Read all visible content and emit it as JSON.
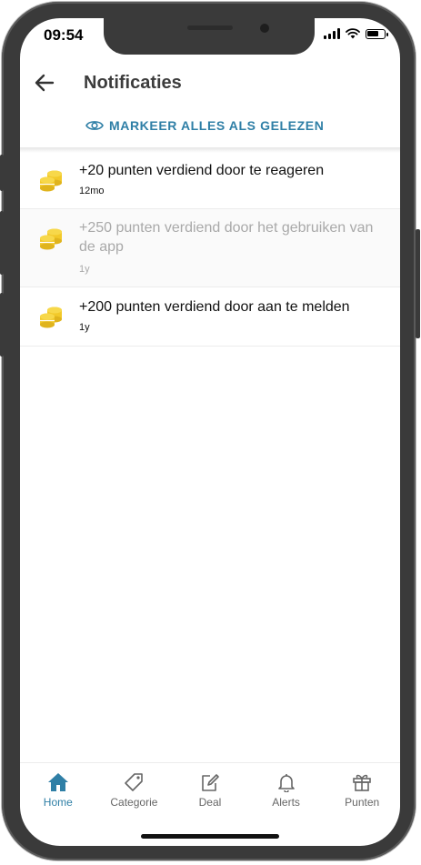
{
  "status_bar": {
    "time": "09:54",
    "icons": [
      "signal-icon",
      "wifi-icon",
      "battery-icon"
    ]
  },
  "header": {
    "back_icon": "arrow-left-icon",
    "title": "Notificaties"
  },
  "mark_all": {
    "icon": "eye-icon",
    "label": "MARKEER ALLES ALS GELEZEN"
  },
  "notifications": [
    {
      "icon": "coins-icon",
      "text": "+20 punten verdiend door te reageren",
      "time": "12mo",
      "read": false
    },
    {
      "icon": "coins-icon",
      "text": "+250 punten verdiend door het gebruiken van de app",
      "time": "1y",
      "read": true
    },
    {
      "icon": "coins-icon",
      "text": "+200 punten verdiend door aan te melden",
      "time": "1y",
      "read": false
    }
  ],
  "bottom_nav": {
    "items": [
      {
        "label": "Home",
        "icon": "home-icon",
        "active": true
      },
      {
        "label": "Categorie",
        "icon": "tag-icon",
        "active": false
      },
      {
        "label": "Deal",
        "icon": "edit-icon",
        "active": false
      },
      {
        "label": "Alerts",
        "icon": "bell-icon",
        "active": false
      },
      {
        "label": "Punten",
        "icon": "gift-icon",
        "active": false
      }
    ]
  },
  "colors": {
    "accent": "#2f7fa6",
    "coin": "#f2c92a",
    "read_text": "#a9a9a9"
  }
}
